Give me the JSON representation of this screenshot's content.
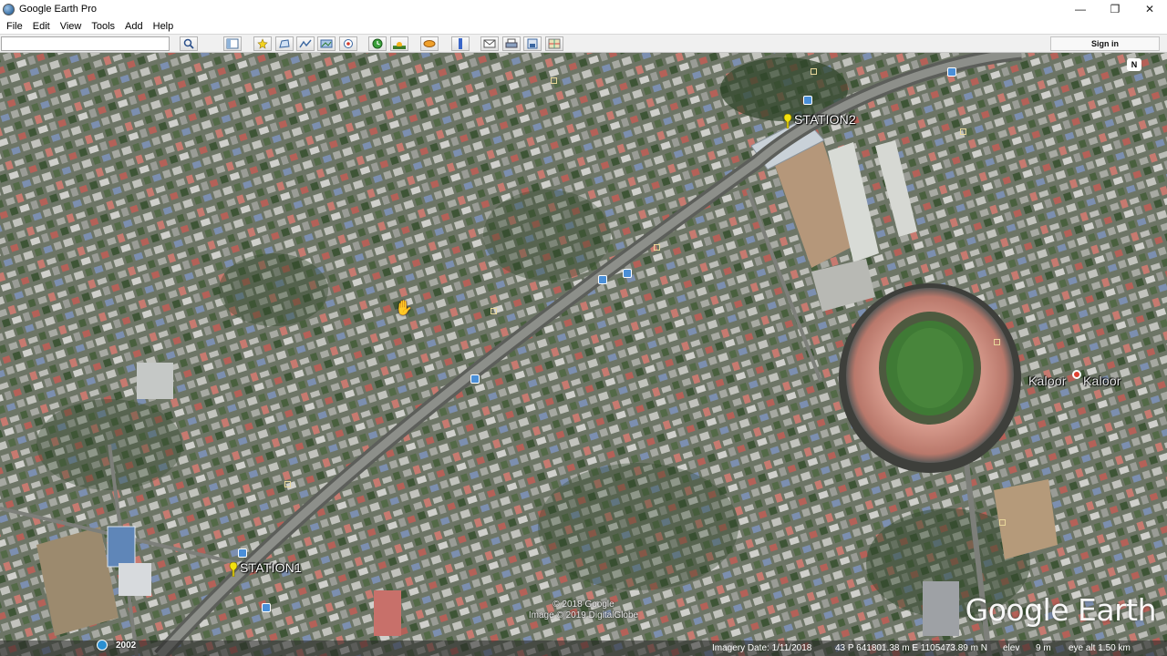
{
  "window": {
    "title": "Google Earth Pro",
    "minimize": "—",
    "restore": "❐",
    "close": "✕"
  },
  "menu": [
    "File",
    "Edit",
    "View",
    "Tools",
    "Add",
    "Help"
  ],
  "toolbar": {
    "search_value": "",
    "sign_in": "Sign in",
    "buttons": [
      "search-icon",
      "sidebar-icon",
      "placemark-icon",
      "polygon-icon",
      "path-icon",
      "overlay-icon",
      "tour-icon",
      "historical-imagery-icon",
      "sun-icon",
      "planets-icon",
      "ruler-icon",
      "email-icon",
      "print-icon",
      "save-image-icon",
      "maps-icon"
    ]
  },
  "map": {
    "placemarks": [
      {
        "label": "STATION2"
      },
      {
        "label": "STATION1"
      },
      {
        "label": "Kaloor"
      }
    ],
    "compass_label": "N",
    "logo": "Google Earth",
    "copyright_1": "© 2018 Google",
    "copyright_2": "Image © 2019 DigitalGlobe",
    "year": "2002",
    "status": {
      "imagery_date": "Imagery Date: 1/11/2018",
      "coordinates": "43 P 641801.38 m E 1105473.89 m N",
      "elev_label": "elev",
      "elev_value": "9 m",
      "eye_alt": "eye alt  1.50 km"
    },
    "colors": {
      "label": "#ffffff",
      "pin": "#f2e20f",
      "poi": "#4a8fd8",
      "track": "#8d8f8a",
      "stadium_roof": "#c98f82",
      "pitch": "#3f7a35"
    }
  }
}
